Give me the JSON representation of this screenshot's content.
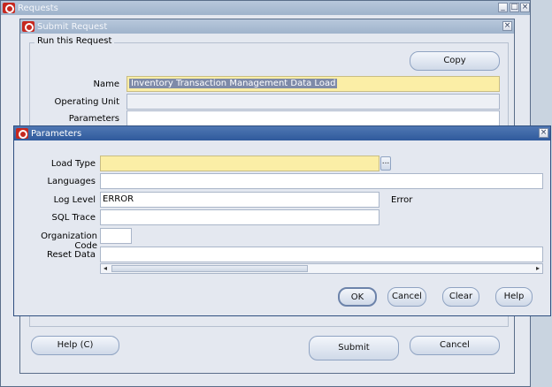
{
  "requests_window": {
    "title": "Requests"
  },
  "submit_window": {
    "title": "Submit Request",
    "group_label": "Run this Request",
    "copy_label": "Copy",
    "fields": [
      {
        "label": "Name",
        "value": "Inventory Transaction Management Data Load"
      },
      {
        "label": "Operating Unit",
        "value": ""
      },
      {
        "label": "Parameters",
        "value": ""
      }
    ],
    "help_label": "Help (C)",
    "submit_label": "Submit",
    "cancel_label": "Cancel"
  },
  "parameters_window": {
    "title": "Parameters",
    "fields": [
      {
        "label": "Load Type",
        "value": ""
      },
      {
        "label": "Languages",
        "value": ""
      },
      {
        "label": "Log Level",
        "value": "ERROR",
        "description": "Error"
      },
      {
        "label": "SQL Trace",
        "value": ""
      },
      {
        "label": "Organization Code",
        "value": ""
      },
      {
        "label": "Reset Data",
        "value": ""
      }
    ],
    "lov_button_label": "...",
    "ok_label": "OK",
    "cancel_label": "Cancel",
    "clear_label": "Clear",
    "help_label": "Help"
  }
}
